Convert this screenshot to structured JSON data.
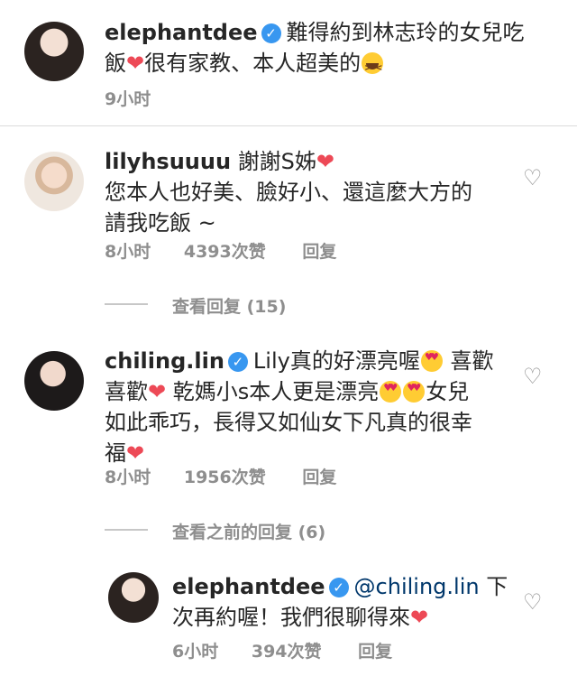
{
  "caption": {
    "username": "elephantdee",
    "text_1": "難得約到林志玲的女兒吃",
    "text_2a": "飯",
    "text_2b": "很有家教、本人超美的",
    "time": "9小时"
  },
  "comments": [
    {
      "username": "lilyhsuuuu",
      "line1": "謝謝S姊",
      "line2": "您本人也好美、臉好小、還這麼大方的",
      "line3": "請我吃飯 ~",
      "time": "8小时",
      "likes": "4393次赞",
      "reply_label": "回复",
      "view_replies": "查看回复 (15)"
    },
    {
      "username": "chiling.lin",
      "line1": "Lily真的好漂亮喔",
      "line1b": "喜歡",
      "line2a": "喜歡",
      "line2b": "乾媽小s本人更是漂亮",
      "line2c": "女兒",
      "line3": "如此乖巧，長得又如仙女下凡真的很幸",
      "line4": "福",
      "time": "8小时",
      "likes": "1956次赞",
      "reply_label": "回复",
      "view_replies": "查看之前的回复 (6)"
    },
    {
      "username": "elephantdee",
      "mention": "@chiling.lin",
      "line1b": "下",
      "line2": "次再約喔！我們很聊得來",
      "time": "6小时",
      "likes": "394次赞",
      "reply_label": "回复"
    }
  ],
  "icons": {
    "heart_glyph": "❤",
    "like_glyph": "♡",
    "verified_glyph": "✓"
  },
  "colors": {
    "verified": "#3897f0",
    "heart": "#ed4956",
    "mention": "#00376b",
    "muted": "#8e8e8e"
  }
}
